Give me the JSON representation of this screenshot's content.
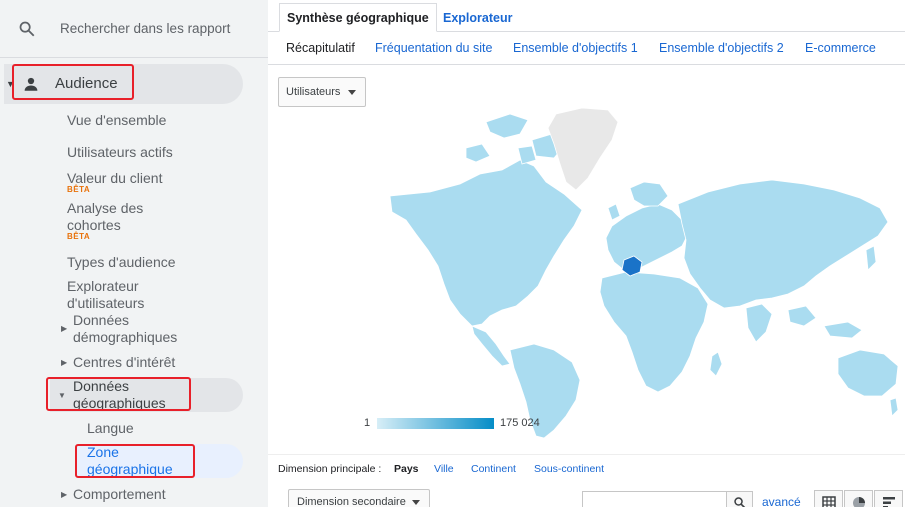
{
  "search": {
    "placeholder": "Rechercher dans les rapport",
    "icon": "search-icon"
  },
  "sidebar": {
    "section": {
      "label": "Audience",
      "icon": "person-icon"
    },
    "items": [
      {
        "label": "Vue d'ensemble"
      },
      {
        "label": "Utilisateurs actifs"
      },
      {
        "label": "Valeur du client",
        "badge": "BÊTA"
      },
      {
        "label_lines": [
          "Analyse des",
          "cohortes"
        ],
        "badge": "BÊTA"
      },
      {
        "label": "Types d'audience"
      },
      {
        "label_lines": [
          "Explorateur",
          "d'utilisateurs"
        ]
      },
      {
        "label_lines": [
          "Données",
          "démographiques"
        ]
      },
      {
        "label": "Centres d'intérêt"
      },
      {
        "label_lines": [
          "Données",
          "géographiques"
        ]
      },
      {
        "label": "Langue"
      },
      {
        "label_lines": [
          "Zone",
          "géographique"
        ]
      },
      {
        "label": "Comportement"
      }
    ]
  },
  "tabs": [
    {
      "label": "Synthèse géographique",
      "active": true
    },
    {
      "label": "Explorateur",
      "active": false
    }
  ],
  "subtabs": [
    "Récapitulatif",
    "Fréquentation du site",
    "Ensemble d'objectifs 1",
    "Ensemble d'objectifs 2",
    "E-commerce"
  ],
  "metric_select": {
    "value": "Utilisateurs"
  },
  "legend": {
    "min": "1",
    "max": "175 024",
    "color_low": "#d7eef7",
    "color_high": "#058dc7"
  },
  "dimension": {
    "label": "Dimension principale :",
    "selected": "Pays",
    "options": [
      "Ville",
      "Continent",
      "Sous-continent"
    ]
  },
  "secondary": {
    "label": "Dimension secondaire"
  },
  "table_search": {
    "advanced_label": "avancé"
  },
  "colors": {
    "map_fill": "#aadcf0",
    "highlight": "#1a73c8",
    "greenland": "#e8e8e8",
    "annotation": "#e8202a"
  }
}
